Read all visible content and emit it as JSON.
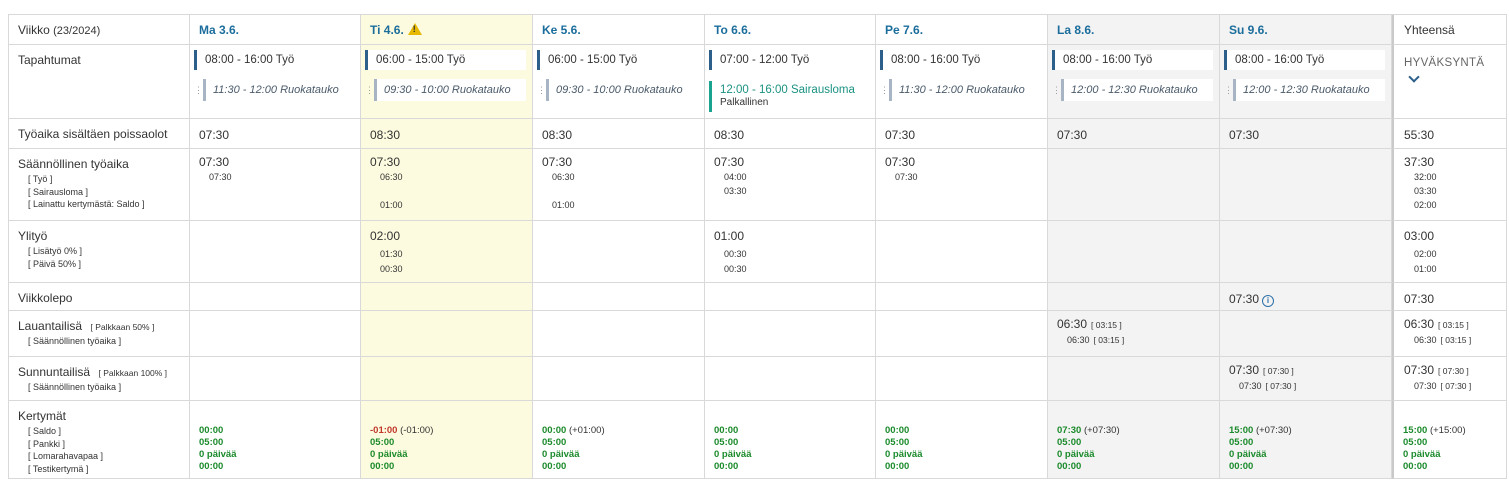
{
  "header": {
    "week_label": "Viikko",
    "week_num": "(23/2024)",
    "total_label": "Yhteensä"
  },
  "days": [
    {
      "name": "Ma 3.6.",
      "warn": false
    },
    {
      "name": "Ti 4.6.",
      "warn": true
    },
    {
      "name": "Ke 5.6.",
      "warn": false
    },
    {
      "name": "To 6.6.",
      "warn": false
    },
    {
      "name": "Pe 7.6.",
      "warn": false
    },
    {
      "name": "La 8.6.",
      "warn": false
    },
    {
      "name": "Su 9.6.",
      "warn": false
    }
  ],
  "rows": {
    "events": {
      "label": "Tapahtumat"
    },
    "worktime": {
      "label": "Työaika sisältäen poissaolot"
    },
    "regular": {
      "label": "Säännöllinen työaika",
      "subs": [
        "[ Työ ]",
        "[ Sairausloma ]",
        "[ Lainattu kertymästä: Saldo ]"
      ]
    },
    "overtime": {
      "label": "Ylityö",
      "subs": [
        "[ Lisätyö 0% ]",
        "[ Päivä 50% ]"
      ]
    },
    "weekrest": {
      "label": "Viikkolepo"
    },
    "saturday": {
      "label": "Lauantailisä",
      "extra": "[ Palkkaan 50% ]",
      "subs": [
        "[ Säännöllinen työaika ]"
      ]
    },
    "sunday": {
      "label": "Sunnuntailisä",
      "extra": "[ Palkkaan 100% ]",
      "subs": [
        "[ Säännöllinen työaika ]"
      ]
    },
    "accruals": {
      "label": "Kertymät",
      "subs": [
        "[ Saldo ]",
        "[ Pankki ]",
        "[ Lomarahavapaa ]",
        "[ Testikertymä ]"
      ]
    }
  },
  "events": [
    {
      "work": "08:00 - 16:00 Työ",
      "brk": "11:30 - 12:00 Ruokatauko"
    },
    {
      "work": "06:00 - 15:00 Työ",
      "brk": "09:30 - 10:00 Ruokatauko"
    },
    {
      "work": "06:00 - 15:00 Työ",
      "brk": "09:30 - 10:00 Ruokatauko"
    },
    {
      "work": "07:00 - 12:00 Työ",
      "sick": "12:00 - 16:00 Sairausloma",
      "sick_sub": "Palkallinen"
    },
    {
      "work": "08:00 - 16:00 Työ",
      "brk": "11:30 - 12:00 Ruokatauko"
    },
    {
      "work": "08:00 - 16:00 Työ",
      "brk": "12:00 - 12:30 Ruokatauko"
    },
    {
      "work": "08:00 - 16:00 Työ",
      "brk": "12:00 - 12:30 Ruokatauko"
    }
  ],
  "approve_label": "HYVÄKSYNTÄ",
  "worktime": [
    "07:30",
    "08:30",
    "08:30",
    "08:30",
    "07:30",
    "07:30",
    "07:30",
    "55:30"
  ],
  "regular": [
    {
      "main": "07:30",
      "v": [
        "07:30",
        "",
        ""
      ]
    },
    {
      "main": "07:30",
      "v": [
        "06:30",
        "",
        "01:00"
      ]
    },
    {
      "main": "07:30",
      "v": [
        "06:30",
        "",
        "01:00"
      ]
    },
    {
      "main": "07:30",
      "v": [
        "04:00",
        "03:30",
        ""
      ]
    },
    {
      "main": "07:30",
      "v": [
        "07:30",
        "",
        ""
      ]
    },
    {
      "main": "",
      "v": [
        "",
        "",
        ""
      ]
    },
    {
      "main": "",
      "v": [
        "",
        "",
        ""
      ]
    },
    {
      "main": "37:30",
      "v": [
        "32:00",
        "03:30",
        "02:00"
      ]
    }
  ],
  "overtime": [
    {
      "main": "",
      "v": [
        "",
        ""
      ]
    },
    {
      "main": "02:00",
      "v": [
        "01:30",
        "00:30"
      ]
    },
    {
      "main": "",
      "v": [
        "",
        ""
      ]
    },
    {
      "main": "01:00",
      "v": [
        "00:30",
        "00:30"
      ]
    },
    {
      "main": "",
      "v": [
        "",
        ""
      ]
    },
    {
      "main": "",
      "v": [
        "",
        ""
      ]
    },
    {
      "main": "",
      "v": [
        "",
        ""
      ]
    },
    {
      "main": "03:00",
      "v": [
        "02:00",
        "01:00"
      ]
    }
  ],
  "weekrest": [
    "",
    "",
    "",
    "",
    "",
    "",
    "07:30",
    "07:30"
  ],
  "saturday": [
    {
      "main": "",
      "b": "",
      "s": "",
      "sb": ""
    },
    {
      "main": "",
      "b": "",
      "s": "",
      "sb": ""
    },
    {
      "main": "",
      "b": "",
      "s": "",
      "sb": ""
    },
    {
      "main": "",
      "b": "",
      "s": "",
      "sb": ""
    },
    {
      "main": "",
      "b": "",
      "s": "",
      "sb": ""
    },
    {
      "main": "06:30",
      "b": "[ 03:15 ]",
      "s": "06:30",
      "sb": "[ 03:15 ]"
    },
    {
      "main": "",
      "b": "",
      "s": "",
      "sb": ""
    },
    {
      "main": "06:30",
      "b": "[ 03:15 ]",
      "s": "06:30",
      "sb": "[ 03:15 ]"
    }
  ],
  "sunday": [
    {
      "main": "",
      "b": "",
      "s": "",
      "sb": ""
    },
    {
      "main": "",
      "b": "",
      "s": "",
      "sb": ""
    },
    {
      "main": "",
      "b": "",
      "s": "",
      "sb": ""
    },
    {
      "main": "",
      "b": "",
      "s": "",
      "sb": ""
    },
    {
      "main": "",
      "b": "",
      "s": "",
      "sb": ""
    },
    {
      "main": "",
      "b": "",
      "s": "",
      "sb": ""
    },
    {
      "main": "07:30",
      "b": "[ 07:30 ]",
      "s": "07:30",
      "sb": "[ 07:30 ]"
    },
    {
      "main": "07:30",
      "b": "[ 07:30 ]",
      "s": "07:30",
      "sb": "[ 07:30 ]"
    }
  ],
  "accruals": [
    {
      "saldo": "00:00",
      "delta": "",
      "neg": false,
      "pankki": "05:00",
      "loma": "0 päivää",
      "testi": "00:00"
    },
    {
      "saldo": "-01:00",
      "delta": "(-01:00)",
      "neg": true,
      "pankki": "05:00",
      "loma": "0 päivää",
      "testi": "00:00"
    },
    {
      "saldo": "00:00",
      "delta": "(+01:00)",
      "neg": false,
      "pankki": "05:00",
      "loma": "0 päivää",
      "testi": "00:00"
    },
    {
      "saldo": "00:00",
      "delta": "",
      "neg": false,
      "pankki": "05:00",
      "loma": "0 päivää",
      "testi": "00:00"
    },
    {
      "saldo": "00:00",
      "delta": "",
      "neg": false,
      "pankki": "05:00",
      "loma": "0 päivää",
      "testi": "00:00"
    },
    {
      "saldo": "07:30",
      "delta": "(+07:30)",
      "neg": false,
      "pankki": "05:00",
      "loma": "0 päivää",
      "testi": "00:00"
    },
    {
      "saldo": "15:00",
      "delta": "(+07:30)",
      "neg": false,
      "pankki": "05:00",
      "loma": "0 päivää",
      "testi": "00:00"
    },
    {
      "saldo": "15:00",
      "delta": "(+15:00)",
      "neg": false,
      "pankki": "05:00",
      "loma": "0 päivää",
      "testi": "00:00"
    }
  ],
  "colors": {
    "accent": "#1b6d9c",
    "today_bg": "#fdfbdf",
    "weekend_bg": "#f3f3f3",
    "positive": "#1a8a2a",
    "negative": "#c0392b",
    "sick": "#1aa38f"
  }
}
